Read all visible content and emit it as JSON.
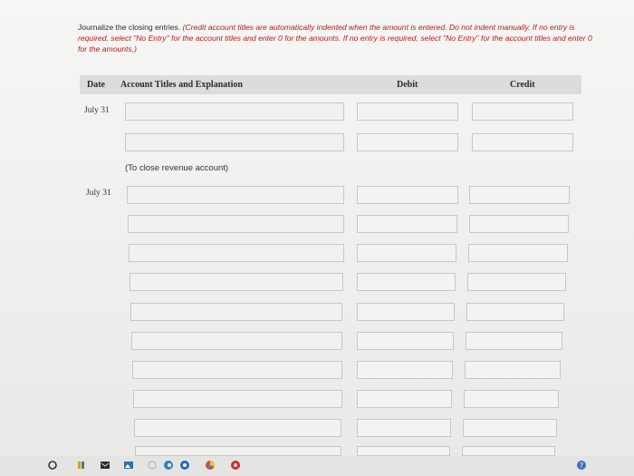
{
  "instructions": {
    "lead": "Journalize the closing entries.",
    "emphasis": "(Credit account titles are automatically indented when the amount is entered. Do not indent manually. If no entry is required, select \"No Entry\" for the account titles and enter 0 for the amounts. If no entry is required, select \"No Entry\" for the account titles and enter 0 for the amounts.)"
  },
  "table": {
    "headers": {
      "date": "Date",
      "account": "Account Titles and Explanation",
      "debit": "Debit",
      "credit": "Credit"
    },
    "entries": [
      {
        "date": "July 31",
        "note": "(To close revenue account)"
      },
      {
        "date": "July 31",
        "note": ""
      }
    ]
  },
  "colors": {
    "emphasis_text": "#b51b1b",
    "header_bg": "#dcdcdb",
    "field_border": "#c7c7c5"
  },
  "taskbar": {
    "icons": [
      "start-icon",
      "file-explorer-icon",
      "mail-icon",
      "photos-icon",
      "cortana-icon",
      "edge-icon",
      "chrome-icon",
      "browser-icon",
      "help-icon"
    ]
  }
}
